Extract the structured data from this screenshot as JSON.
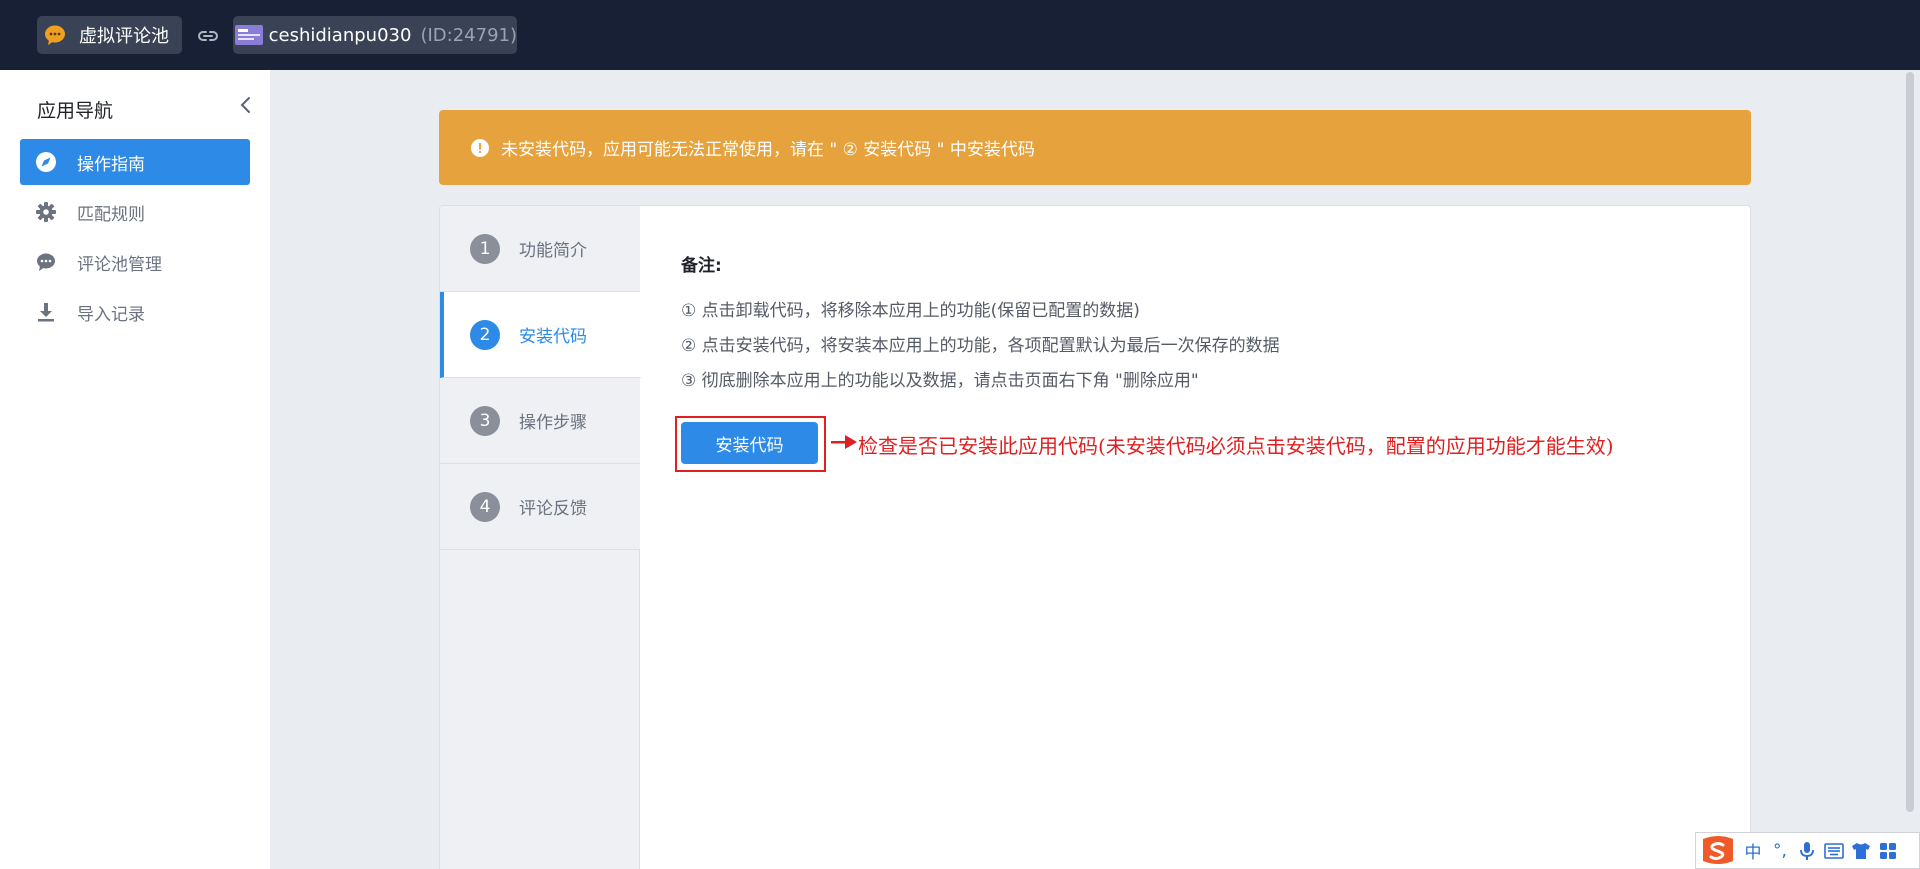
{
  "topbar": {
    "app_name": "虚拟评论池",
    "shop_name": "ceshidianpu030",
    "shop_id": "(ID:24791)"
  },
  "sidebar": {
    "title": "应用导航",
    "items": [
      {
        "label": "操作指南",
        "icon": "compass-icon",
        "active": true
      },
      {
        "label": "匹配规则",
        "icon": "gear-icon",
        "active": false
      },
      {
        "label": "评论池管理",
        "icon": "comment-icon",
        "active": false
      },
      {
        "label": "导入记录",
        "icon": "download-icon",
        "active": false
      }
    ]
  },
  "alert": {
    "text": "未安装代码，应用可能无法正常使用，请在 \" ② 安装代码 \" 中安装代码",
    "color": "#e6a23c"
  },
  "steps": [
    {
      "num": "1",
      "label": "功能简介"
    },
    {
      "num": "2",
      "label": "安装代码"
    },
    {
      "num": "3",
      "label": "操作步骤"
    },
    {
      "num": "4",
      "label": "评论反馈"
    }
  ],
  "content": {
    "note_title": "备注:",
    "notes": [
      "① 点击卸载代码，将移除本应用上的功能(保留已配置的数据)",
      "② 点击安装代码，将安装本应用上的功能，各项配置默认为最后一次保存的数据",
      "③ 彻底删除本应用上的功能以及数据，请点击页面右下角 \"删除应用\""
    ],
    "install_button": "安装代码",
    "annotation": "检查是否已安装此应用代码(未安装代码必须点击安装代码，配置的应用功能才能生效)"
  },
  "ime": {
    "items": [
      "中",
      "°,",
      "mic",
      "keyboard",
      "shirt",
      "grid"
    ]
  },
  "colors": {
    "accent": "#2d8ae6",
    "topbar": "#172034",
    "warning": "#e6a23c",
    "annotation": "#e02020"
  }
}
